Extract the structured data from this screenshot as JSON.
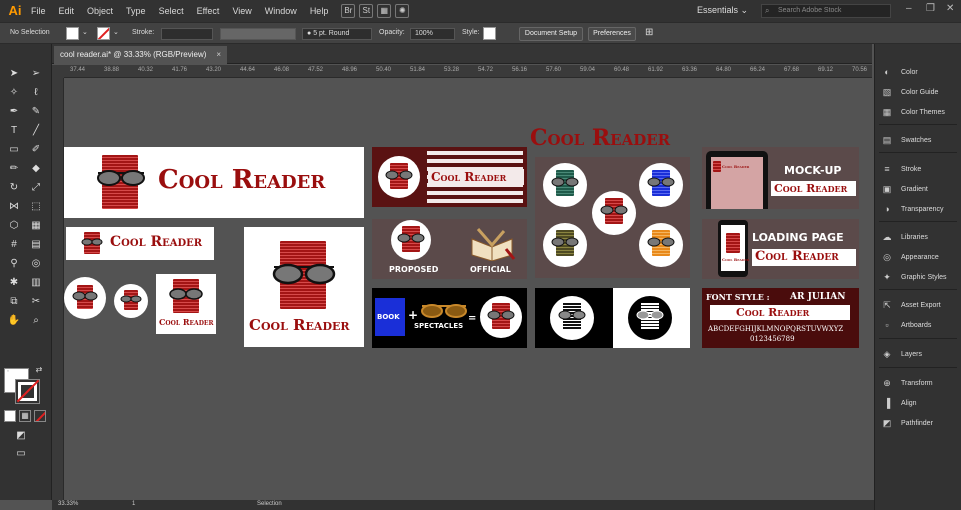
{
  "app": {
    "logo": "Ai"
  },
  "menu": [
    "File",
    "Edit",
    "Object",
    "Type",
    "Select",
    "Effect",
    "View",
    "Window",
    "Help"
  ],
  "menu_buttons": {
    "bridge": "Br",
    "stock": "St"
  },
  "workspace": "Essentials ⌄",
  "search": {
    "placeholder": "Search Adobe Stock"
  },
  "control": {
    "selection": "No Selection",
    "stroke_label": "Stroke:",
    "stroke_style": "5 pt. Round",
    "opacity_label": "Opacity:",
    "opacity_value": "100%",
    "style_label": "Style:",
    "document_setup": "Document Setup",
    "preferences": "Preferences"
  },
  "document_tab": {
    "title": "cool reader.ai* @ 33.33% (RGB/Preview)",
    "close": "×"
  },
  "ruler_ticks": [
    "37.44",
    "38.88",
    "40.32",
    "41.76",
    "43.20",
    "44.64",
    "46.08",
    "47.52",
    "48.96",
    "50.40",
    "51.84",
    "53.28",
    "54.72",
    "56.16",
    "57.60",
    "59.04",
    "60.48",
    "61.92",
    "63.36",
    "64.80",
    "66.24",
    "67.68",
    "69.12",
    "70.56"
  ],
  "panels": [
    {
      "icon": "◐",
      "label": "Color",
      "name": "color-icon"
    },
    {
      "icon": "▧",
      "label": "Color Guide",
      "name": "color-guide-icon"
    },
    {
      "icon": "▦",
      "label": "Color Themes",
      "name": "color-themes-icon"
    },
    {
      "icon": "▤",
      "label": "Swatches",
      "name": "swatches-icon"
    },
    {
      "icon": "≡",
      "label": "Stroke",
      "name": "stroke-icon"
    },
    {
      "icon": "▣",
      "label": "Gradient",
      "name": "gradient-icon"
    },
    {
      "icon": "◑",
      "label": "Transparency",
      "name": "transparency-icon"
    },
    {
      "icon": "☁",
      "label": "Libraries",
      "name": "libraries-icon"
    },
    {
      "icon": "◎",
      "label": "Appearance",
      "name": "appearance-icon"
    },
    {
      "icon": "✦",
      "label": "Graphic Styles",
      "name": "graphic-styles-icon"
    },
    {
      "icon": "⇱",
      "label": "Asset Export",
      "name": "asset-export-icon"
    },
    {
      "icon": "▫",
      "label": "Artboards",
      "name": "artboards-icon"
    },
    {
      "icon": "◈",
      "label": "Layers",
      "name": "layers-icon"
    },
    {
      "icon": "⊕",
      "label": "Transform",
      "name": "transform-icon"
    },
    {
      "icon": "▐",
      "label": "Align",
      "name": "align-icon"
    },
    {
      "icon": "◩",
      "label": "Pathfinder",
      "name": "pathfinder-icon"
    }
  ],
  "status": {
    "zoom": "33.33%",
    "page": "1",
    "tool": "Selection"
  },
  "artwork": {
    "brand": "Cool Reader",
    "big_title": "Cool Reader",
    "proposed": "PROPOSED",
    "official": "OFFICIAL",
    "book": "BOOK",
    "plus": "+",
    "spectacles": "SPECTACLES",
    "equals": "=",
    "mockup": "MOCK-UP",
    "loading": "LOADING PAGE",
    "font_style_label": "FONT STYLE :",
    "font_name": "AR JULIAN",
    "alphabet": "ABCDEFGHIJKLMNOPQRSTUVWXYZ",
    "digits": "0123456789",
    "phone_caption": "Cool Reader"
  },
  "colors": {
    "accent": "#9a0e0e",
    "book_green": "#1f5a4a",
    "book_blue": "#1a2fd8",
    "book_olive": "#4e4a22",
    "book_orange": "#e8891a",
    "mockup_bg": "#5b4a4a"
  }
}
